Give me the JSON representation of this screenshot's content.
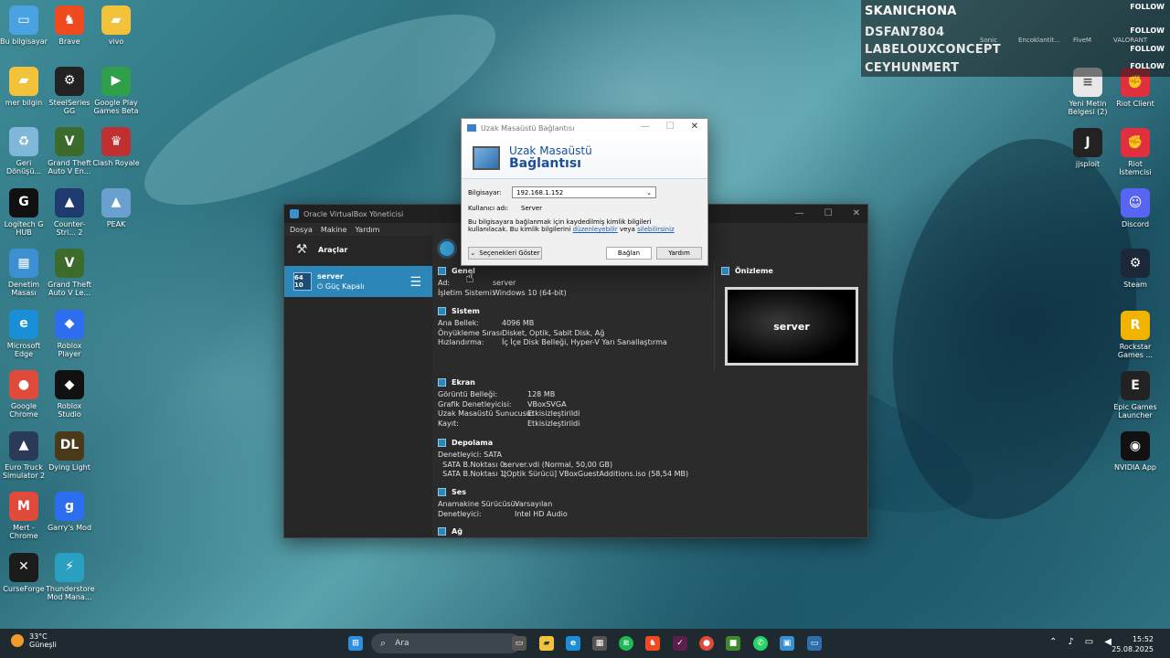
{
  "desktop_left": [
    {
      "label": "Bu bilgisayar",
      "icon": "computer-icon",
      "color": "#4aa3e0",
      "glyph": "▭"
    },
    {
      "label": "mer bilgin",
      "icon": "folder-icon",
      "color": "#f2c23b",
      "glyph": "▰"
    },
    {
      "label": "Geri Dönüşü...",
      "icon": "recycle-bin-icon",
      "color": "#7fb7d8",
      "glyph": "♻"
    },
    {
      "label": "Logitech G HUB",
      "icon": "logitech-icon",
      "color": "#111",
      "glyph": "G"
    },
    {
      "label": "Denetim Masası",
      "icon": "control-panel-icon",
      "color": "#3c8fd0",
      "glyph": "▦"
    },
    {
      "label": "Microsoft Edge",
      "icon": "edge-icon",
      "color": "#1a8fd8",
      "glyph": "e"
    },
    {
      "label": "Google Chrome",
      "icon": "chrome-icon",
      "color": "#e04a3a",
      "glyph": "●"
    },
    {
      "label": "Euro Truck Simulator 2",
      "icon": "ets2-icon",
      "color": "#2a3b58",
      "glyph": "▲"
    },
    {
      "label": "Mert - Chrome",
      "icon": "chrome-profile-icon",
      "color": "#e04a3a",
      "glyph": "M"
    },
    {
      "label": "CurseForge",
      "icon": "curseforge-icon",
      "color": "#1b1b1b",
      "glyph": "✕"
    }
  ],
  "desktop_col2": [
    {
      "label": "Brave",
      "icon": "brave-icon",
      "color": "#f04a20",
      "glyph": "♞"
    },
    {
      "label": "SteelSeries GG",
      "icon": "steelseries-icon",
      "color": "#222",
      "glyph": "⚙"
    },
    {
      "label": "Grand Theft Auto V En...",
      "icon": "gta-v-icon",
      "color": "#3d6b2c",
      "glyph": "V"
    },
    {
      "label": "Counter-Stri... 2",
      "icon": "cs2-icon",
      "color": "#1e3a6e",
      "glyph": "▲"
    },
    {
      "label": "Grand Theft Auto V Le...",
      "icon": "gta-v-icon",
      "color": "#3d6b2c",
      "glyph": "V"
    },
    {
      "label": "Roblox Player",
      "icon": "roblox-icon",
      "color": "#2d6df0",
      "glyph": "◆"
    },
    {
      "label": "Roblox Studio",
      "icon": "roblox-studio-icon",
      "color": "#111",
      "glyph": "◆"
    },
    {
      "label": "Dying Light",
      "icon": "dying-light-icon",
      "color": "#4a3a1a",
      "glyph": "DL"
    },
    {
      "label": "Garry's Mod",
      "icon": "gmod-icon",
      "color": "#2d6df0",
      "glyph": "g"
    },
    {
      "label": "Thunderstore Mod Mana...",
      "icon": "thunderstore-icon",
      "color": "#2aa0c0",
      "glyph": "⚡"
    }
  ],
  "desktop_col3": [
    {
      "label": "vivo",
      "icon": "folder-icon",
      "color": "#f2c23b",
      "glyph": "▰"
    },
    {
      "label": "Google Play Games Beta",
      "icon": "play-games-icon",
      "color": "#2fa04a",
      "glyph": "▶"
    },
    {
      "label": "Clash Royale",
      "icon": "clash-royale-icon",
      "color": "#c03030",
      "glyph": "♛"
    },
    {
      "label": "PEAK",
      "icon": "peak-icon",
      "color": "#6aa0d0",
      "glyph": "▲"
    }
  ],
  "desktop_right": [
    {
      "label": "Yeni Metin Belgesi (2)",
      "icon": "text-file-icon",
      "color": "#e8e8e8",
      "glyph": "≡"
    },
    {
      "label": "jjsploit",
      "icon": "jjsploit-icon",
      "color": "#222",
      "glyph": "J"
    },
    {
      "label": "Riot Client",
      "icon": "riot-icon",
      "color": "#e03040",
      "glyph": "✊"
    },
    {
      "label": "Riot İstemcisi",
      "icon": "riot-icon",
      "color": "#e03040",
      "glyph": "✊"
    },
    {
      "label": "Discord",
      "icon": "discord-icon",
      "color": "#5865f2",
      "glyph": "☺"
    },
    {
      "label": "Steam",
      "icon": "steam-icon",
      "color": "#1b2838",
      "glyph": "⚙"
    },
    {
      "label": "Rockstar Games ...",
      "icon": "rockstar-icon",
      "color": "#f0b400",
      "glyph": "R"
    },
    {
      "label": "Epic Games Launcher",
      "icon": "epic-icon",
      "color": "#222",
      "glyph": "E"
    },
    {
      "label": "NVIDIA App",
      "icon": "nvidia-icon",
      "color": "#111",
      "glyph": "◉"
    }
  ],
  "overlay_top_icons": [
    "Sonic",
    "Encoklantit...",
    "FiveM",
    "VALORANT"
  ],
  "follow_overlay": {
    "names": [
      "SKANICHONA",
      "DSFAN7804",
      "LABELOUXCONCEPT",
      "CEYHUNMERT"
    ],
    "tag": "FOLLOW"
  },
  "vbox": {
    "title": "Oracle VirtualBox Yöneticisi",
    "menu": [
      "Dosya",
      "Makine",
      "Yardım"
    ],
    "tools_label": "Araçlar",
    "vm": {
      "name": "server",
      "state": "Güç Kapalı",
      "badge": "64 10"
    },
    "preview_title": "Önizleme",
    "preview_text": "server",
    "sections": {
      "genel": {
        "title": "Genel",
        "rows": [
          [
            "Ad:",
            "server"
          ],
          [
            "İşletim Sistemi:",
            "Windows 10 (64-bit)"
          ]
        ]
      },
      "sistem": {
        "title": "Sistem",
        "rows": [
          [
            "Ana Bellek:",
            "4096 MB"
          ],
          [
            "Önyükleme Sırası:",
            "Disket, Optik, Sabit Disk, Ağ"
          ],
          [
            "Hızlandırma:",
            "İç İçe Disk Belleği, Hyper-V Yarı Sanallaştırma"
          ]
        ]
      },
      "ekran": {
        "title": "Ekran",
        "rows": [
          [
            "Görüntü Belleği:",
            "128 MB"
          ],
          [
            "Grafik Denetleyicisi:",
            "VBoxSVGA"
          ],
          [
            "Uzak Masaüstü Sunucusu:",
            "Etkisizleştirildi"
          ],
          [
            "Kayıt:",
            "Etkisizleştirildi"
          ]
        ]
      },
      "depolama": {
        "title": "Depolama",
        "rows": [
          [
            "Denetleyici: SATA",
            ""
          ],
          [
            "  SATA B.Noktası 0:",
            "server.vdi (Normal, 50,00 GB)"
          ],
          [
            "  SATA B.Noktası 1:",
            "[Optik Sürücü] VBoxGuestAdditions.iso (58,54 MB)"
          ]
        ]
      },
      "ses": {
        "title": "Ses",
        "rows": [
          [
            "Anamakine Sürücüsü:",
            "Varsayılan"
          ],
          [
            "Denetleyici:",
            "Intel HD Audio"
          ]
        ]
      },
      "ag": {
        "title": "Ağ"
      }
    }
  },
  "rdp": {
    "title": "Uzak Masaüstü Bağlantısı",
    "banner_line1": "Uzak Masaüstü",
    "banner_line2": "Bağlantısı",
    "computer_label": "Bilgisayar:",
    "computer_value": "192.168.1.152",
    "user_label": "Kullanıcı adı:",
    "user_value": "Server",
    "note_1": "Bu bilgisayara bağlanmak için kaydedilmiş kimlik bilgileri",
    "note_2": "kullanılacak.  Bu kimlik bilgilerini ",
    "note_link1": "düzenleyebilir",
    "note_mid": " veya ",
    "note_link2": "silebilirsiniz",
    "options_btn": "Seçenekleri Göster",
    "connect_btn": "Bağlan",
    "help_btn": "Yardım"
  },
  "taskbar": {
    "weather_temp": "33°C",
    "weather_desc": "Güneşli",
    "search_placeholder": "Ara",
    "time": "15:52",
    "date": "25.08.2025"
  }
}
